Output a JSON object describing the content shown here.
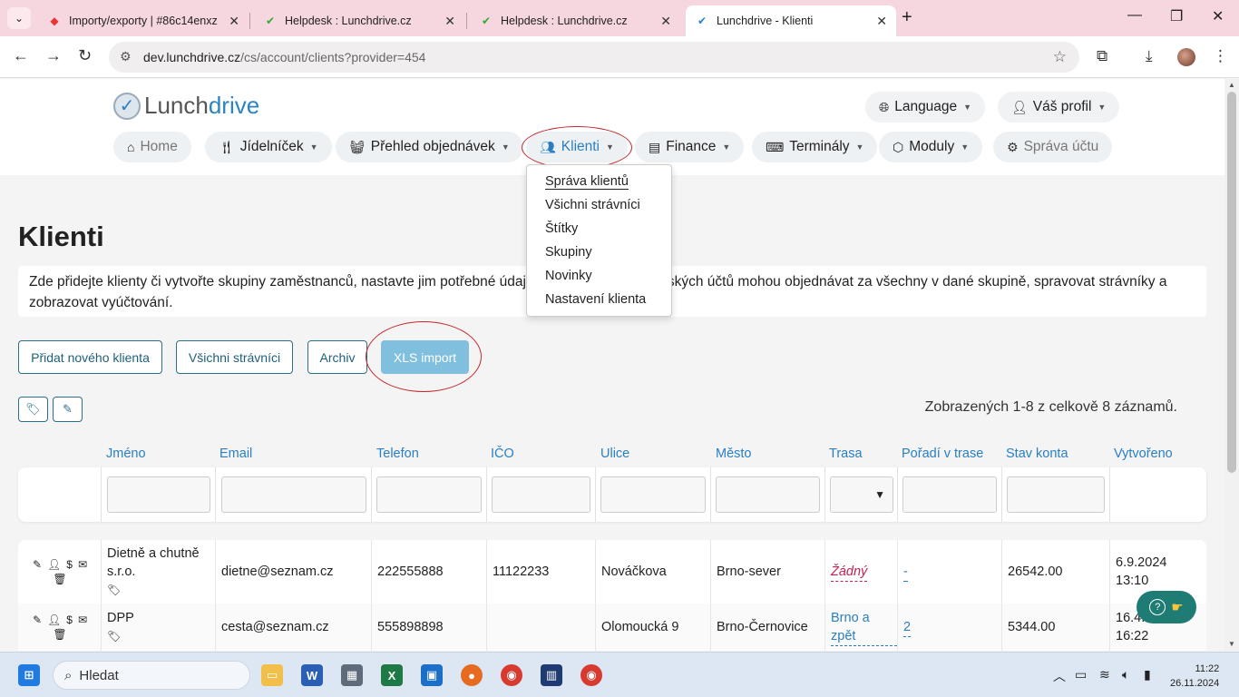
{
  "browser": {
    "tabs": [
      {
        "title": "Importy/exporty | #86c14enxz",
        "active": false
      },
      {
        "title": "Helpdesk : Lunchdrive.cz",
        "active": false
      },
      {
        "title": "Helpdesk : Lunchdrive.cz",
        "active": false
      },
      {
        "title": "Lunchdrive - Klienti",
        "active": true
      }
    ],
    "url_host": "dev.lunchdrive.cz",
    "url_path": "/cs/account/clients?provider=454"
  },
  "logo": {
    "part1": "Lunch",
    "part2": "drive"
  },
  "topnav": {
    "language": "Language",
    "profile": "Váš profil"
  },
  "nav": {
    "home": "Home",
    "menu": "Jídelníček",
    "orders": "Přehled objednávek",
    "clients": "Klienti",
    "finance": "Finance",
    "terminals": "Terminály",
    "modules": "Moduly",
    "account": "Správa účtu"
  },
  "dropdown": {
    "items": [
      "Správa klientů",
      "Všichni strávníci",
      "Štítky",
      "Skupiny",
      "Novinky",
      "Nastavení klienta"
    ]
  },
  "page": {
    "title": "Klienti",
    "description": "Zde přidejte klienty či vytvořte skupiny zaměstnanců, nastavte jim potřebné údaje. Správci těchto klientských účtů mohou objednávat za všechny v dané skupině, spravovat strávníky a zobrazovat vyúčtování.",
    "buttons": {
      "add": "Přidat nového klienta",
      "all": "Všichni strávníci",
      "archive": "Archiv",
      "xls": "XLS import"
    },
    "count": "Zobrazených 1-8 z celkově 8 záznamů."
  },
  "table": {
    "headers": [
      "Jméno",
      "Email",
      "Telefon",
      "IČO",
      "Ulice",
      "Město",
      "Trasa",
      "Pořadí v trase",
      "Stav konta",
      "Vytvořeno"
    ],
    "rows": [
      {
        "name": "Dietně a chutně s.r.o.",
        "email": "dietne@seznam.cz",
        "phone": "222555888",
        "ico": "11122233",
        "street": "Nováčkova",
        "city": "Brno-sever",
        "route": "Žádný",
        "order": "-",
        "balance": "26542.00",
        "created_date": "6.9.2024",
        "created_time": "13:10"
      },
      {
        "name": "DPP",
        "email": "cesta@seznam.cz",
        "phone": "555898898",
        "ico": "",
        "street": "Olomoucká 9",
        "city": "Brno-Černovice",
        "route": "Brno a zpět",
        "order": "2",
        "balance": "5344.00",
        "created_date": "16.4.",
        "created_time": "16:22"
      }
    ]
  },
  "taskbar": {
    "search": "Hledat",
    "time": "11:22",
    "date": "26.11.2024"
  },
  "colors": {
    "accent": "#2a84c6",
    "annotation": "#c0282d",
    "xls_button": "#80bfdd",
    "help": "#1e7c74"
  }
}
